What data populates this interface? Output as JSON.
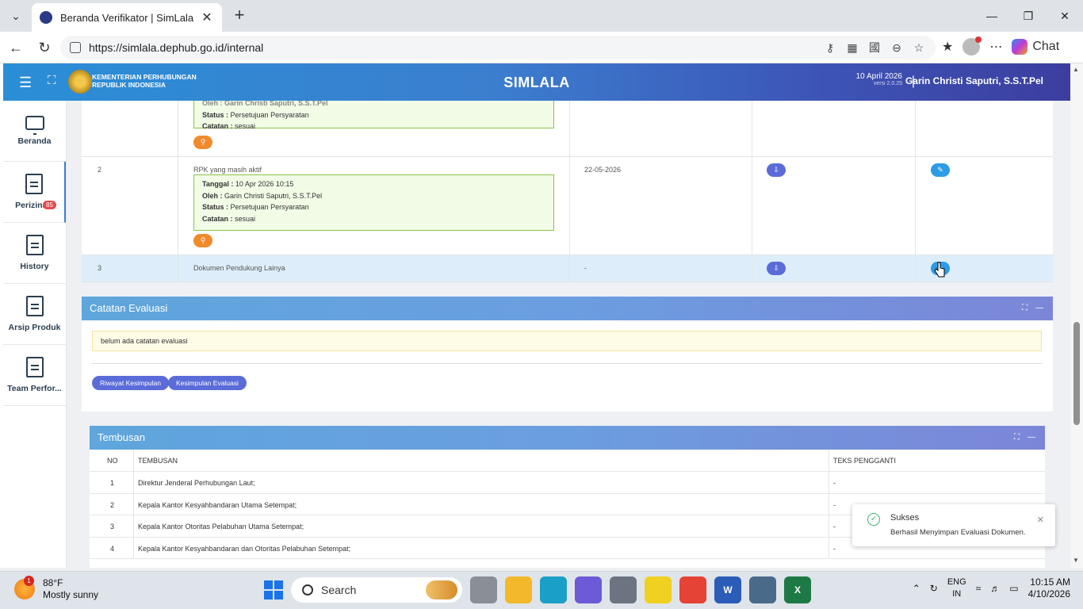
{
  "browser": {
    "tab_title": "Beranda Verifikator | SimLala",
    "url": "https://simlala.dephub.go.id/internal",
    "chat_label": "Chat"
  },
  "header": {
    "org_line1": "KEMENTERIAN PERHUBUNGAN",
    "org_line2": "REPUBLIK INDONESIA",
    "app_title": "SIMLALA",
    "date": "10 April 2026",
    "version": "versi 2.0.25",
    "separator": "|",
    "user": "Garin Christi Saputri, S.S.T.Pel"
  },
  "sidebar": {
    "items": [
      {
        "label": "Beranda"
      },
      {
        "label": "Perizinan",
        "badge": "85"
      },
      {
        "label": "History"
      },
      {
        "label": "Arsip Produk"
      },
      {
        "label": "Team Perfor..."
      }
    ]
  },
  "documents": {
    "row1_partial": {
      "oleh_partial": "Oleh : Garin Christi Saputri, S.S.T.Pel",
      "status_label": "Status :",
      "status_value": "Persetujuan Persyaratan",
      "catatan_label": "Catatan :",
      "catatan_value": "sesuai"
    },
    "row2": {
      "no": "2",
      "name": "RPK yang masih aktif",
      "tanggal_label": "Tanggal :",
      "tanggal_value": "10 Apr 2026 10:15",
      "oleh_label": "Oleh :",
      "oleh_value": "Garin Christi Saputri, S.S.T.Pel",
      "status_label": "Status :",
      "status_value": "Persetujuan Persyaratan",
      "catatan_label": "Catatan :",
      "catatan_value": "sesuai",
      "date": "22-05-2026"
    },
    "row3": {
      "no": "3",
      "name": "Dokumen Pendukung Lainya",
      "date": "-"
    }
  },
  "evaluasi": {
    "title": "Catatan Evaluasi",
    "empty_note": "belum ada catatan evaluasi",
    "btn_riwayat": "Riwayat Kesimpulan",
    "btn_kesimpulan": "Kesimpulan Evaluasi"
  },
  "tembusan": {
    "title": "Tembusan",
    "columns": [
      "NO",
      "TEMBUSAN",
      "TEKS PENGGANTI"
    ],
    "rows": [
      {
        "no": "1",
        "text": "Direktur Jenderal Perhubungan Laut;",
        "pengganti": "-"
      },
      {
        "no": "2",
        "text": "Kepala Kantor Kesyahbandaran Utama Setempat;",
        "pengganti": "-"
      },
      {
        "no": "3",
        "text": "Kepala Kantor Otoritas Pelabuhan Utama Setempat;",
        "pengganti": "-"
      },
      {
        "no": "4",
        "text": "Kepala Kantor Kesyahbandaran dan Otoritas Pelabuhan Setempat;",
        "pengganti": "-"
      }
    ]
  },
  "toast": {
    "title": "Sukses",
    "message": "Berhasil Menyimpan Evaluasi Dokumen."
  },
  "taskbar": {
    "temp": "88°F",
    "weather": "Mostly sunny",
    "search": "Search",
    "lang1": "ENG",
    "lang2": "IN",
    "time": "10:15 AM",
    "date": "4/10/2026"
  }
}
